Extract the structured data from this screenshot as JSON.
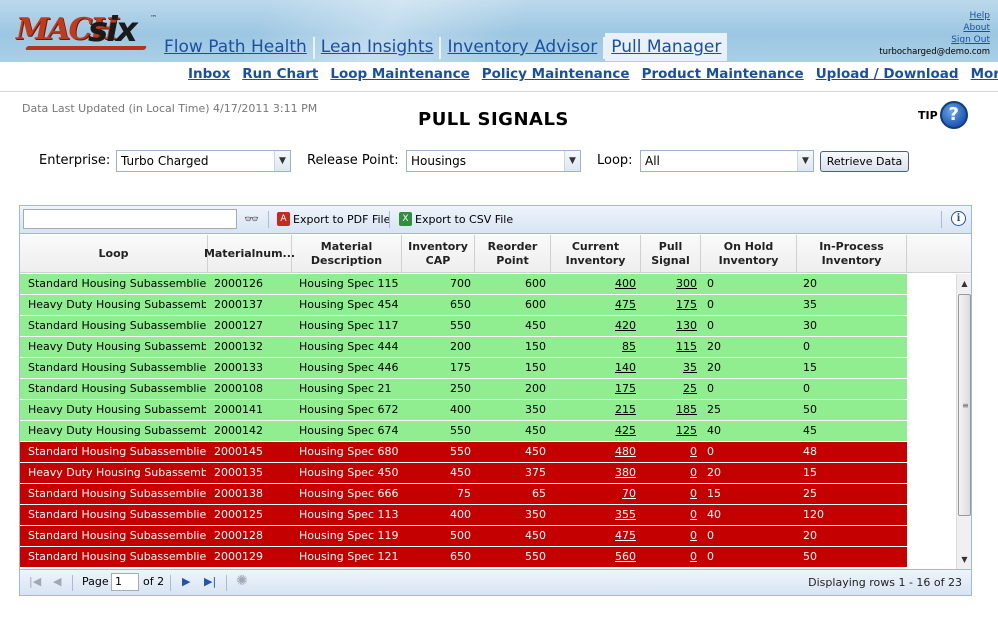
{
  "logo": {
    "mach": "MACH",
    "six": "six",
    "tm": "™"
  },
  "main_tabs": [
    {
      "label": "Flow Path Health"
    },
    {
      "label": "Lean Insights"
    },
    {
      "label": "Inventory Advisor"
    },
    {
      "label": "Pull Manager",
      "active": true
    }
  ],
  "user_links": {
    "help": "Help",
    "about": "About",
    "sign_out": "Sign Out",
    "email": "turbocharged@demo.com"
  },
  "subnav": [
    "Inbox",
    "Run Chart",
    "Loop Maintenance",
    "Policy Maintenance",
    "Product Maintenance",
    "Upload / Download",
    "More..."
  ],
  "updated": "Data Last Updated (in Local Time) 4/17/2011 3:11 PM",
  "title": "PULL SIGNALS",
  "tip": "TIP",
  "filters": {
    "enterprise_label": "Enterprise:",
    "enterprise_value": "Turbo Charged",
    "release_label": "Release Point:",
    "release_value": "Housings",
    "loop_label": "Loop:",
    "loop_value": "All",
    "retrieve_label": "Retrieve Data"
  },
  "toolbar": {
    "pdf": "Export to PDF File",
    "csv": "Export to CSV File",
    "search_value": ""
  },
  "columns": [
    "Loop",
    "Materialnum...",
    "Material Description",
    "Inventory CAP",
    "Reorder Point",
    "Current Inventory",
    "Pull Signal",
    "On Hold Inventory",
    "In-Process Inventory"
  ],
  "rows": [
    {
      "status": "green",
      "cells": [
        "Standard Housing Subassemblies",
        "2000126",
        "Housing Spec 115",
        "700",
        "600",
        "400",
        "300",
        "0",
        "20"
      ]
    },
    {
      "status": "green",
      "cells": [
        "Heavy Duty Housing Subassemblies",
        "2000137",
        "Housing Spec 454",
        "650",
        "600",
        "475",
        "175",
        "0",
        "35"
      ]
    },
    {
      "status": "green",
      "cells": [
        "Standard Housing Subassemblies",
        "2000127",
        "Housing Spec 117",
        "550",
        "450",
        "420",
        "130",
        "0",
        "30"
      ]
    },
    {
      "status": "green",
      "cells": [
        "Heavy Duty Housing Subassemblies",
        "2000132",
        "Housing Spec 444",
        "200",
        "150",
        "85",
        "115",
        "20",
        "0"
      ]
    },
    {
      "status": "green",
      "cells": [
        "Standard Housing Subassemblies",
        "2000133",
        "Housing Spec 446",
        "175",
        "150",
        "140",
        "35",
        "20",
        "15"
      ]
    },
    {
      "status": "green",
      "cells": [
        "Standard Housing Subassemblies",
        "2000108",
        "Housing Spec 21",
        "250",
        "200",
        "175",
        "25",
        "0",
        "0"
      ]
    },
    {
      "status": "green",
      "cells": [
        "Heavy Duty Housing Subassemblies",
        "2000141",
        "Housing Spec 672",
        "400",
        "350",
        "215",
        "185",
        "25",
        "50"
      ]
    },
    {
      "status": "green",
      "cells": [
        "Heavy Duty Housing Subassemblies",
        "2000142",
        "Housing Spec 674",
        "550",
        "450",
        "425",
        "125",
        "40",
        "45"
      ]
    },
    {
      "status": "red",
      "cells": [
        "Standard Housing Subassemblies",
        "2000145",
        "Housing Spec 680",
        "550",
        "450",
        "480",
        "0",
        "0",
        "48"
      ]
    },
    {
      "status": "red",
      "cells": [
        "Heavy Duty Housing Subassemblies",
        "2000135",
        "Housing Spec 450",
        "450",
        "375",
        "380",
        "0",
        "20",
        "15"
      ]
    },
    {
      "status": "red",
      "cells": [
        "Standard Housing Subassemblies",
        "2000138",
        "Housing Spec 666",
        "75",
        "65",
        "70",
        "0",
        "15",
        "25"
      ]
    },
    {
      "status": "red",
      "cells": [
        "Standard Housing Subassemblies",
        "2000125",
        "Housing Spec 113",
        "400",
        "350",
        "355",
        "0",
        "40",
        "120"
      ]
    },
    {
      "status": "red",
      "cells": [
        "Standard Housing Subassemblies",
        "2000128",
        "Housing Spec 119",
        "500",
        "450",
        "475",
        "0",
        "0",
        "20"
      ]
    },
    {
      "status": "red",
      "cells": [
        "Standard Housing Subassemblies",
        "2000129",
        "Housing Spec 121",
        "650",
        "550",
        "560",
        "0",
        "0",
        "50"
      ]
    }
  ],
  "row_colors": {
    "green": "#90ee90",
    "red": "#c40000"
  },
  "pager": {
    "page_label": "Page",
    "page_value": "1",
    "of_label": "of 2",
    "info": "Displaying rows 1 - 16 of 23"
  },
  "icons": {
    "search": "binoculars-icon",
    "pdf": "pdf-icon",
    "csv": "csv-icon",
    "info": "info-icon",
    "help": "question-icon"
  }
}
